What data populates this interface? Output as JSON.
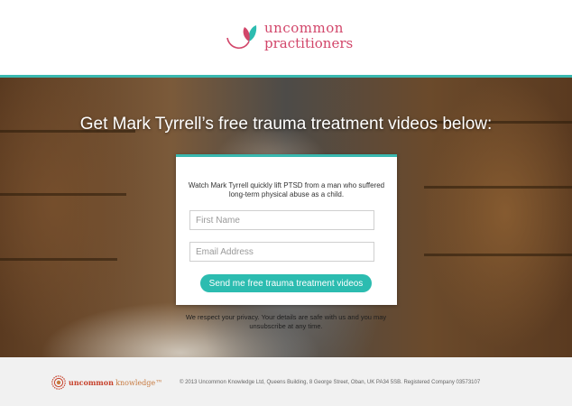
{
  "header": {
    "logo_line1": "uncommon",
    "logo_line2": "practitioners"
  },
  "hero": {
    "headline": "Get Mark Tyrrell’s free trauma treatment videos below:"
  },
  "form": {
    "intro": "Watch Mark Tyrrell quickly lift PTSD from a man who suffered long-term physical abuse as a child.",
    "first_name_placeholder": "First Name",
    "email_placeholder": "Email Address",
    "submit_label": "Send me free trauma treatment videos",
    "privacy_note": "We respect your privacy. Your details are safe with us and you may unsubscribe at any time."
  },
  "footer": {
    "brand_primary": "uncommon",
    "brand_secondary": "knowledge",
    "brand_mark": "™",
    "copyright": "© 2013 Uncommon Knowledge Ltd, Queens Building, 8 George Street, Oban, UK PA34 5SB. Registered Company 03573107"
  },
  "colors": {
    "accent_teal": "#39b9b0",
    "brand_pink": "#d2466a",
    "brand_red": "#c7412b"
  },
  "icons": {
    "header_logo": "leaf-flower-icon",
    "footer_logo": "sun-emblem-icon"
  }
}
